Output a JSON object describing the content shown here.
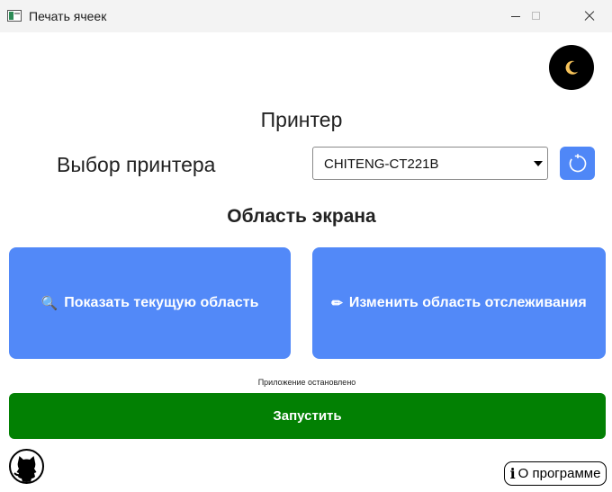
{
  "window": {
    "title": "Печать ячеек"
  },
  "theme_toggle": {
    "icon": "moon-icon"
  },
  "printer_section": {
    "heading": "Принтер",
    "select_label": "Выбор принтера",
    "selected_printer": "CHITENG-CT221B",
    "refresh_icon": "refresh-icon"
  },
  "screen_area": {
    "heading": "Область экрана",
    "show_button": {
      "icon": "🔍",
      "label": "Показать текущую область"
    },
    "change_button": {
      "icon": "✏",
      "label": "Изменить область отслеживания"
    }
  },
  "status": "Приложение остановлено",
  "start_button": "Запустить",
  "footer": {
    "github_icon": "github-icon",
    "about_icon": "i",
    "about_label": "О программе"
  },
  "colors": {
    "accent_blue": "#5289f8",
    "start_green": "#028003",
    "titlebar": "#f3f3f3"
  }
}
